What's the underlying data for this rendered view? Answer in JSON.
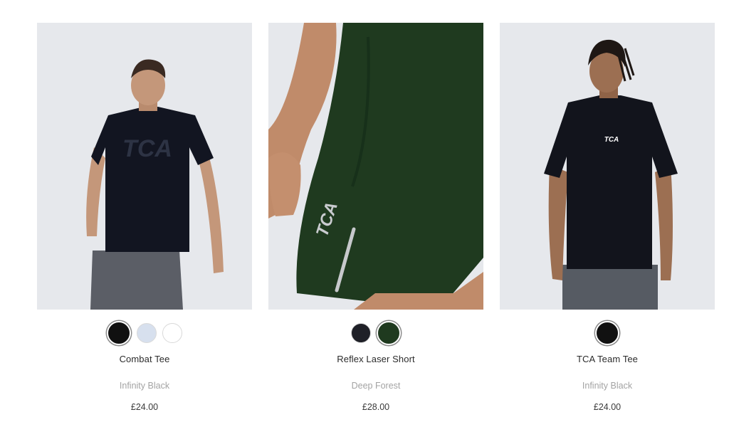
{
  "products": [
    {
      "name": "Combat Tee",
      "colour": "Infinity Black",
      "price": "£24.00",
      "image_alt": "combat-tee-photo",
      "swatches": [
        {
          "color": "#111111",
          "selected": true
        },
        {
          "color": "#d7e0ee",
          "selected": false
        },
        {
          "color": "#ffffff",
          "selected": false
        }
      ],
      "logo_text": "TCA"
    },
    {
      "name": "Reflex Laser Short",
      "colour": "Deep Forest",
      "price": "£28.00",
      "image_alt": "reflex-laser-short-photo",
      "swatches": [
        {
          "color": "#1f2027",
          "selected": false
        },
        {
          "color": "#1f3a1f",
          "selected": true
        }
      ],
      "logo_text": "TCA"
    },
    {
      "name": "TCA Team Tee",
      "colour": "Infinity Black",
      "price": "£24.00",
      "image_alt": "tca-team-tee-photo",
      "swatches": [
        {
          "color": "#111111",
          "selected": true
        }
      ],
      "logo_text": "TCA"
    }
  ],
  "colors": {
    "image_bg": "#e6e8ec",
    "name_text": "#2b2b2b",
    "colour_text": "#a3a3a3",
    "price_text": "#3a3a3a"
  }
}
